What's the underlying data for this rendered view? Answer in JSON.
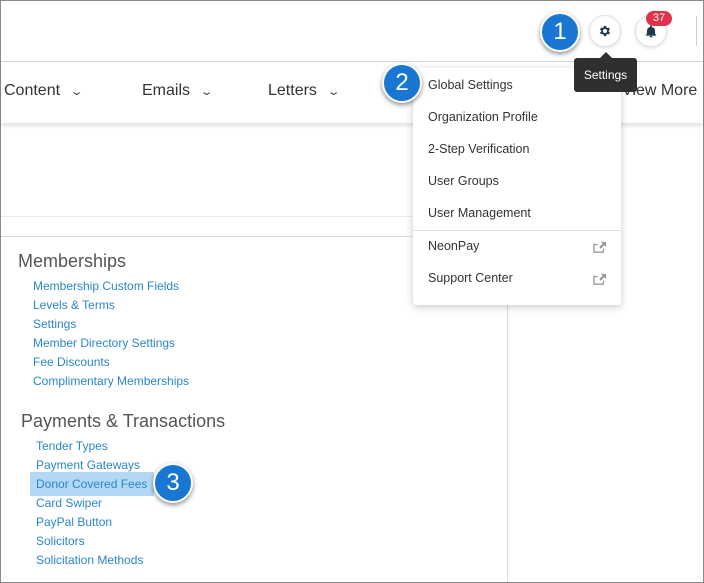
{
  "header": {
    "notification_count": "37",
    "tooltip": "Settings"
  },
  "nav": {
    "items": [
      {
        "label": "Content"
      },
      {
        "label": "Emails"
      },
      {
        "label": "Letters"
      }
    ],
    "view_more": "View More"
  },
  "dropdown": {
    "items": [
      {
        "label": "Global Settings"
      },
      {
        "label": "Organization Profile"
      },
      {
        "label": "2-Step Verification"
      },
      {
        "label": "User Groups"
      },
      {
        "label": "User Management"
      },
      {
        "label": "NeonPay",
        "external": true
      },
      {
        "label": "Support Center",
        "external": true
      }
    ]
  },
  "memberships": {
    "title": "Memberships",
    "links": [
      "Membership Custom Fields",
      "Levels & Terms",
      "Settings",
      "Member Directory Settings",
      "Fee Discounts",
      "Complimentary Memberships"
    ]
  },
  "payments": {
    "title": "Payments & Transactions",
    "links": [
      "Tender Types",
      "Payment Gateways",
      "Donor Covered Fees",
      "Card Swiper",
      "PayPal Button",
      "Solicitors",
      "Solicitation Methods"
    ]
  },
  "steps": [
    "1",
    "2",
    "3"
  ],
  "colors": {
    "link": "#2a86c9",
    "step_marker": "#1976d2",
    "badge": "#e0334a",
    "highlight": "#b3d8f5",
    "tooltip_bg": "#2f2f2f"
  },
  "icons": {
    "settings": "gear-icon",
    "notifications": "bell-icon",
    "external": "external-link-icon",
    "dropdown": "chevron-down-icon"
  }
}
